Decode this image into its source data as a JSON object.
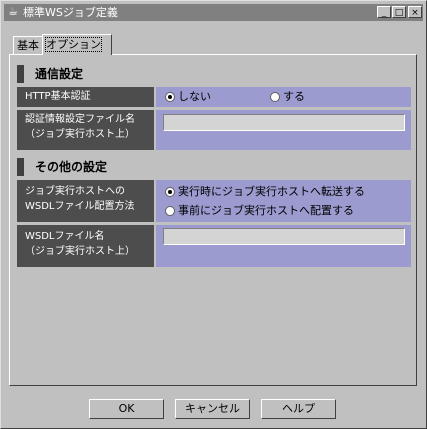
{
  "window": {
    "title": "標準WSジョブ定義",
    "icon": "java-cup-icon"
  },
  "window_buttons": {
    "minimize": "_",
    "maximize": "□",
    "close": "×"
  },
  "tabs": [
    {
      "label": "基本"
    },
    {
      "label": "オプション"
    }
  ],
  "active_tab": 1,
  "sections": {
    "communication": {
      "title": "通信設定",
      "http_auth": {
        "label": "HTTP基本認証",
        "options": [
          {
            "label": "しない",
            "selected": true
          },
          {
            "label": "する",
            "selected": false
          }
        ]
      },
      "auth_file": {
        "label_line1": "認証情報設定ファイル名",
        "label_line2": "（ジョブ実行ホスト上）",
        "value": ""
      }
    },
    "other": {
      "title": "その他の設定",
      "wsdl_placement": {
        "label_line1": "ジョブ実行ホストへの",
        "label_line2": "WSDLファイル配置方法",
        "options": [
          {
            "label": "実行時にジョブ実行ホストへ転送する",
            "selected": true
          },
          {
            "label": "事前にジョブ実行ホストへ配置する",
            "selected": false
          }
        ]
      },
      "wsdl_file": {
        "label_line1": "WSDLファイル名",
        "label_line2": "（ジョブ実行ホスト上）",
        "value": ""
      }
    }
  },
  "buttons": {
    "ok": "OK",
    "cancel": "キャンセル",
    "help": "ヘルプ"
  }
}
